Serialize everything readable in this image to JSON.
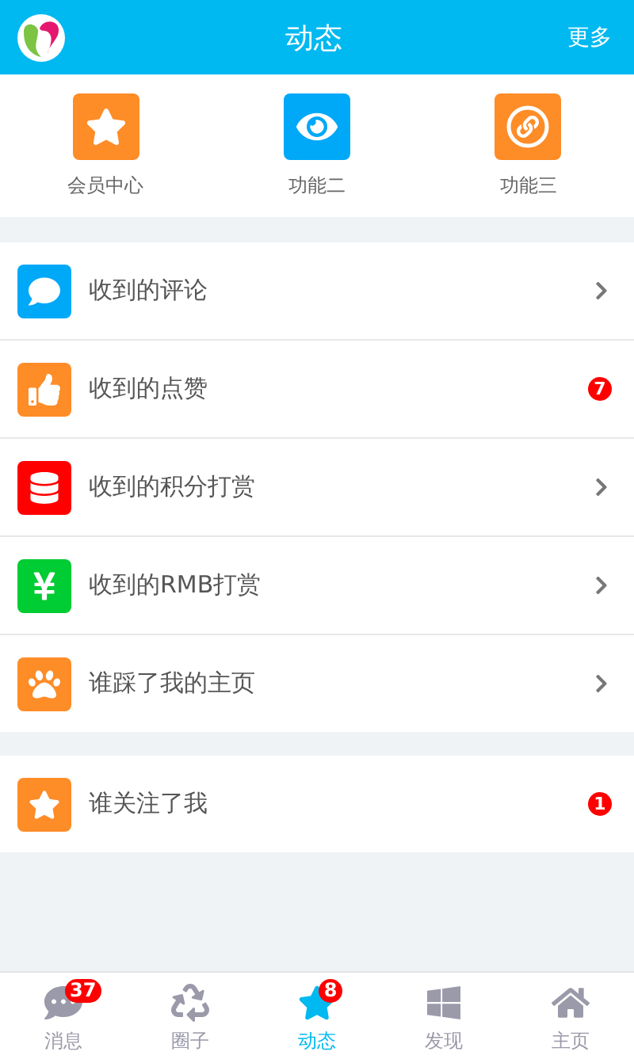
{
  "header": {
    "title": "动态",
    "action": "更多"
  },
  "features": [
    {
      "label": "会员中心",
      "kind": "star",
      "color": "#fe8c27"
    },
    {
      "label": "功能二",
      "kind": "eye",
      "color": "#00a8f8"
    },
    {
      "label": "功能三",
      "kind": "link",
      "color": "#fe8c27"
    }
  ],
  "groups": [
    {
      "items": [
        {
          "label": "收到的评论",
          "kind": "comment",
          "color": "#00a8f8"
        },
        {
          "label": "收到的点赞",
          "kind": "thumb",
          "color": "#fe8c27",
          "badge": "7"
        },
        {
          "label": "收到的积分打赏",
          "kind": "database",
          "color": "#ff0000"
        },
        {
          "label": "收到的RMB打赏",
          "kind": "yuan",
          "color": "#00cc33"
        },
        {
          "label": "谁踩了我的主页",
          "kind": "paw",
          "color": "#fe8c27"
        }
      ]
    },
    {
      "items": [
        {
          "label": "谁关注了我",
          "kind": "star",
          "color": "#fe8c27",
          "badge": "1"
        }
      ]
    }
  ],
  "tabs": [
    {
      "label": "消息",
      "kind": "chat",
      "selected": false,
      "badge": "37"
    },
    {
      "label": "圈子",
      "kind": "recycle",
      "selected": false
    },
    {
      "label": "动态",
      "kind": "star",
      "selected": true,
      "badge": "8"
    },
    {
      "label": "发现",
      "kind": "windows",
      "selected": false
    },
    {
      "label": "主页",
      "kind": "home",
      "selected": false
    }
  ]
}
